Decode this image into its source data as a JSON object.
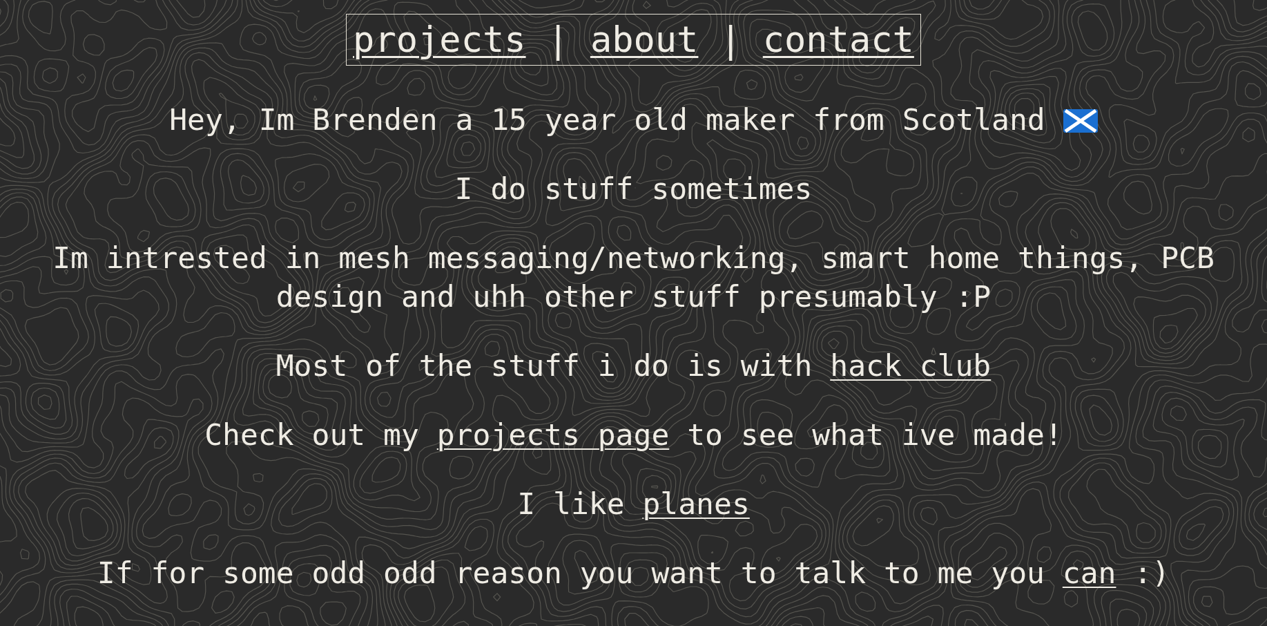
{
  "nav": {
    "items": [
      {
        "kind": "link",
        "label": "projects"
      },
      {
        "kind": "separator",
        "label": "|"
      },
      {
        "kind": "link",
        "label": "about"
      },
      {
        "kind": "separator",
        "label": "|"
      },
      {
        "kind": "link",
        "label": "contact"
      }
    ]
  },
  "paragraphs": [
    {
      "parts": [
        {
          "kind": "text",
          "text": "Hey, Im Brenden a 15 year old maker from Scotland"
        },
        {
          "kind": "flag"
        }
      ]
    },
    {
      "parts": [
        {
          "kind": "text",
          "text": "I do stuff sometimes"
        }
      ]
    },
    {
      "parts": [
        {
          "kind": "text",
          "text": "Im intrested in mesh messaging/networking, smart home things, PCB design and uhh other stuff presumably :P"
        }
      ]
    },
    {
      "parts": [
        {
          "kind": "text",
          "text": "Most of the stuff i do is with "
        },
        {
          "kind": "link",
          "text": "hack club"
        }
      ]
    },
    {
      "parts": [
        {
          "kind": "text",
          "text": "Check out my "
        },
        {
          "kind": "link",
          "text": "projects page"
        },
        {
          "kind": "text",
          "text": " to see what ive made!"
        }
      ]
    },
    {
      "parts": [
        {
          "kind": "text",
          "text": "I like "
        },
        {
          "kind": "link",
          "text": "planes"
        }
      ]
    },
    {
      "parts": [
        {
          "kind": "text",
          "text": "If for some odd odd reason you want to talk to me you "
        },
        {
          "kind": "link",
          "text": "can"
        },
        {
          "kind": "text",
          "text": " :)"
        }
      ]
    }
  ]
}
